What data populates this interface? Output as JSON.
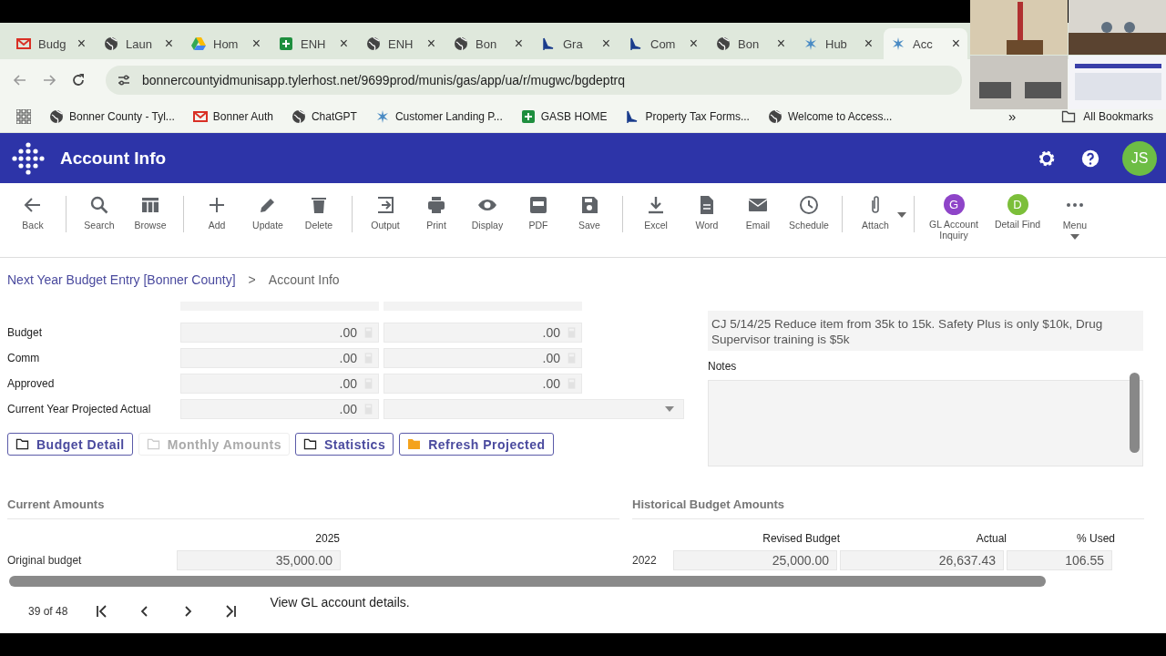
{
  "browser": {
    "tabs": [
      {
        "label": "Budg",
        "selected": false
      },
      {
        "label": "Laun",
        "selected": false
      },
      {
        "label": "Hom",
        "selected": false
      },
      {
        "label": "ENH",
        "selected": false
      },
      {
        "label": "ENH",
        "selected": false
      },
      {
        "label": "Bon",
        "selected": false
      },
      {
        "label": "Gra",
        "selected": false
      },
      {
        "label": "Com",
        "selected": false
      },
      {
        "label": "Bon",
        "selected": false
      },
      {
        "label": "Hub",
        "selected": false
      },
      {
        "label": "Acc",
        "selected": true
      }
    ],
    "close_glyph": "×",
    "url": "bonnercountyidmunisapp.tylerhost.net/9699prod/munis/gas/app/ua/r/mugwc/bgdeptrq",
    "bookmarks": [
      "Bonner County - Tyl...",
      "Bonner Auth",
      "ChatGPT",
      "Customer Landing P...",
      "GASB HOME",
      "Property Tax Forms...",
      "Welcome to Access..."
    ],
    "more_bookmarks": "»",
    "all_bookmarks": "All Bookmarks"
  },
  "app_header": {
    "title": "Account Info",
    "user_initials": "JS"
  },
  "toolbar": {
    "groups": [
      {
        "items": [
          {
            "label": "Back",
            "kind": "icon"
          }
        ]
      },
      {
        "items": [
          {
            "label": "Search",
            "kind": "icon"
          },
          {
            "label": "Browse",
            "kind": "icon"
          }
        ]
      },
      {
        "items": [
          {
            "label": "Add",
            "kind": "icon"
          },
          {
            "label": "Update",
            "kind": "icon"
          },
          {
            "label": "Delete",
            "kind": "icon"
          }
        ]
      },
      {
        "items": [
          {
            "label": "Output",
            "kind": "icon"
          },
          {
            "label": "Print",
            "kind": "icon"
          },
          {
            "label": "Display",
            "kind": "icon"
          },
          {
            "label": "PDF",
            "kind": "icon"
          },
          {
            "label": "Save",
            "kind": "icon"
          }
        ]
      },
      {
        "items": [
          {
            "label": "Excel",
            "kind": "icon"
          },
          {
            "label": "Word",
            "kind": "icon"
          },
          {
            "label": "Email",
            "kind": "icon"
          },
          {
            "label": "Schedule",
            "kind": "icon"
          }
        ]
      },
      {
        "items": [
          {
            "label": "Attach",
            "kind": "dropdown"
          }
        ]
      },
      {
        "items": [
          {
            "label": "GL Account Inquiry",
            "kind": "avatar",
            "letter": "G",
            "color": "#8e44c8"
          },
          {
            "label": "Detail Find",
            "kind": "avatar",
            "letter": "D",
            "color": "#7cbf3a"
          },
          {
            "label": "Menu",
            "kind": "menu"
          }
        ]
      }
    ]
  },
  "breadcrumb": {
    "link": "Next Year Budget Entry [Bonner County]",
    "separator": ">",
    "current": "Account Info"
  },
  "form": {
    "rows": [
      {
        "label": "Budget",
        "value_1": ".00",
        "value_2": ".00",
        "kind": "amounts"
      },
      {
        "label": "Comm",
        "value_1": ".00",
        "value_2": ".00",
        "kind": "amounts"
      },
      {
        "label": "Approved",
        "value_1": ".00",
        "value_2": ".00",
        "kind": "amounts"
      },
      {
        "label": "Current Year Projected Actual",
        "value_1": ".00",
        "kind": "dropdown"
      }
    ],
    "buttons": [
      {
        "label": "Budget Detail",
        "disabled": false,
        "kind": "folder"
      },
      {
        "label": "Monthly Amounts",
        "disabled": true,
        "kind": "folder"
      },
      {
        "label": "Statistics",
        "disabled": false,
        "kind": "folder"
      },
      {
        "label": "Refresh Projected",
        "disabled": false,
        "kind": "orange-folder"
      }
    ]
  },
  "comment": "CJ 5/14/25 Reduce item from 35k to 15k. Safety Plus is only $10k, Drug Supervisor training is $5k",
  "notes": {
    "label": "Notes"
  },
  "current_amounts": {
    "title": "Current Amounts",
    "column": "2025",
    "rows": [
      {
        "label": "Original budget",
        "value": "35,000.00"
      }
    ]
  },
  "historical": {
    "title": "Historical Budget Amounts",
    "columns": [
      "Revised Budget",
      "Actual",
      "% Used"
    ],
    "rows": [
      {
        "year": "2022",
        "values": [
          "25,000.00",
          "26,637.43",
          "106.55"
        ]
      }
    ]
  },
  "footer": {
    "position": "39 of 48",
    "message": "View GL account details."
  }
}
